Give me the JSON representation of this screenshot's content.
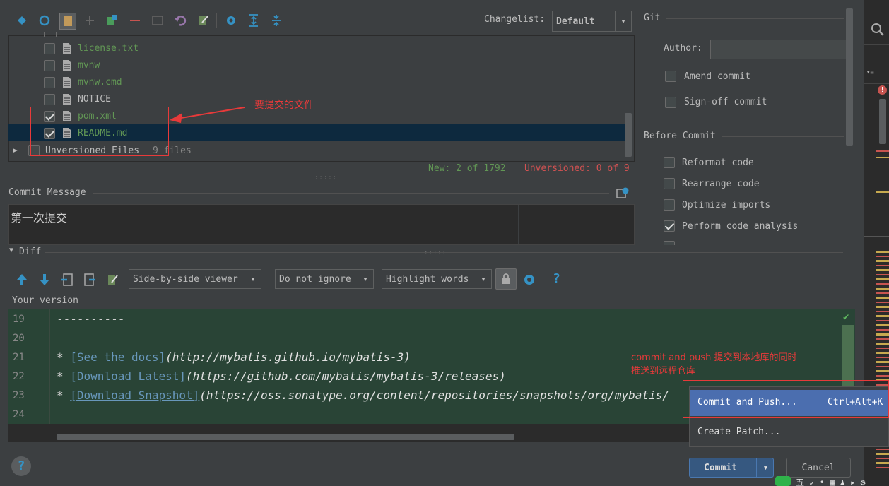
{
  "toolbar": {
    "changelist_label": "Changelist:",
    "changelist_value": "Default",
    "icons": [
      "pin-icon",
      "refresh-icon",
      "file-icon",
      "plus-icon",
      "move-icon",
      "minus-icon",
      "diff-icon",
      "undo-icon",
      "edit-icon",
      "gear-icon",
      "expand-all-icon",
      "collapse-all-icon"
    ]
  },
  "files": [
    {
      "name": "license.txt",
      "checked": false,
      "color": "#629755"
    },
    {
      "name": "mvnw",
      "checked": false,
      "color": "#629755"
    },
    {
      "name": "mvnw.cmd",
      "checked": false,
      "color": "#629755"
    },
    {
      "name": "NOTICE",
      "checked": false,
      "color": "#bbbbbb"
    },
    {
      "name": "pom.xml",
      "checked": true,
      "color": "#629755"
    },
    {
      "name": "README.md",
      "checked": true,
      "color": "#629755"
    }
  ],
  "unversioned": {
    "label": "Unversioned Files",
    "count": "9 files"
  },
  "status": {
    "new": "New: 2 of 1792",
    "unversioned": "Unversioned: 0 of 9"
  },
  "annotations": {
    "files_note": "要提交的文件",
    "push_note_line1": "commit and push 提交到本地库的同时",
    "push_note_line2": "推送到远程仓库"
  },
  "commit_message": {
    "label": "Commit Message",
    "text": "第一次提交"
  },
  "git": {
    "title": "Git",
    "author_label": "Author:",
    "author_value": "",
    "amend_label": "Amend commit",
    "signoff_label": "Sign-off commit"
  },
  "before_commit": {
    "title": "Before Commit",
    "options": [
      {
        "label": "Reformat code",
        "checked": false
      },
      {
        "label": "Rearrange code",
        "checked": false
      },
      {
        "label": "Optimize imports",
        "checked": false
      },
      {
        "label": "Perform code analysis",
        "checked": true
      }
    ]
  },
  "diff": {
    "title": "Diff",
    "viewer": "Side-by-side viewer",
    "ignore": "Do not ignore",
    "highlight": "Highlight words",
    "help": "?",
    "your_version": "Your version",
    "lines": [
      {
        "num": "19",
        "prefix": "----------",
        "link": "",
        "url": "",
        "suffix": ""
      },
      {
        "num": "20",
        "prefix": "",
        "link": "",
        "url": "",
        "suffix": ""
      },
      {
        "num": "21",
        "prefix": "* ",
        "link": "[See the docs]",
        "url": "(http://mybatis.github.io/mybatis-3)",
        "suffix": ""
      },
      {
        "num": "22",
        "prefix": "* ",
        "link": "[Download Latest]",
        "url": "(https://github.com/mybatis/mybatis-3/releases)",
        "suffix": ""
      },
      {
        "num": "23",
        "prefix": "* ",
        "link": "[Download Snapshot]",
        "url": "(https://oss.sonatype.org/content/repositories/snapshots/org/mybatis/",
        "suffix": ""
      },
      {
        "num": "24",
        "prefix": "",
        "link": "",
        "url": "",
        "suffix": ""
      }
    ]
  },
  "popup": {
    "commit_push_label": "Commit and Push...",
    "commit_push_shortcut": "Ctrl+Alt+K",
    "create_patch_label": "Create Patch..."
  },
  "buttons": {
    "commit": "Commit",
    "cancel": "Cancel",
    "help": "?"
  },
  "colors": {
    "selection": "#0d293e",
    "diff_bg": "#294436",
    "popup_selected": "#4b6eaf",
    "annotation_red": "#e83a3a",
    "green_text": "#629755",
    "red_text": "#d25252"
  }
}
